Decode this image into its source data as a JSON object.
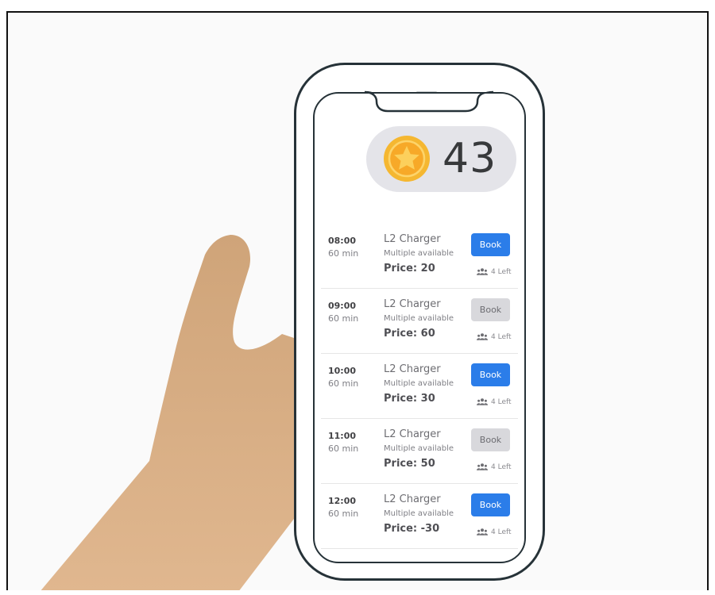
{
  "wallet": {
    "coins": "43",
    "coin_icon": "star-coin-icon",
    "coin_color": "#f5b731"
  },
  "slots": [
    {
      "time": "08:00",
      "duration": "60 min",
      "name": "L2 Charger",
      "availability": "Multiple available",
      "price": "Price: 20",
      "button_label": "Book",
      "button_state": "active",
      "spots_left": "4 Left"
    },
    {
      "time": "09:00",
      "duration": "60 min",
      "name": "L2 Charger",
      "availability": "Multiple available",
      "price": "Price: 60",
      "button_label": "Book",
      "button_state": "disabled",
      "spots_left": "4 Left"
    },
    {
      "time": "10:00",
      "duration": "60 min",
      "name": "L2 Charger",
      "availability": "Multiple available",
      "price": "Price: 30",
      "button_label": "Book",
      "button_state": "active",
      "spots_left": "4 Left"
    },
    {
      "time": "11:00",
      "duration": "60 min",
      "name": "L2 Charger",
      "availability": "Multiple available",
      "price": "Price: 50",
      "button_label": "Book",
      "button_state": "disabled",
      "spots_left": "4 Left"
    },
    {
      "time": "12:00",
      "duration": "60 min",
      "name": "L2 Charger",
      "availability": "Multiple available",
      "price": "Price: -30",
      "button_label": "Book",
      "button_state": "active",
      "spots_left": "4 Left"
    }
  ],
  "colors": {
    "accent": "#2b7de9",
    "disabled_button": "#d8d8dc",
    "phone_outline": "#263238",
    "hand": "#d4a57c"
  }
}
